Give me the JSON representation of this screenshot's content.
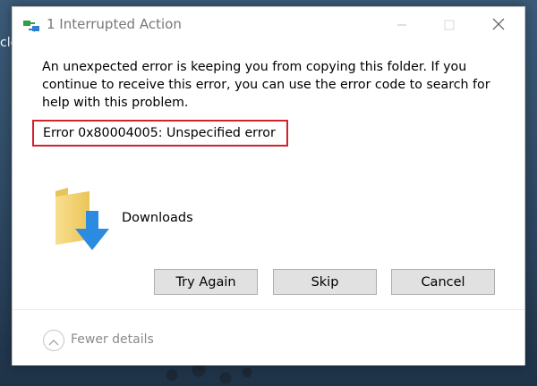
{
  "window": {
    "title": "1 Interrupted Action",
    "app_icon": "file-transfer-icon",
    "controls": [
      "minimize-icon",
      "maximize-icon",
      "close-icon"
    ]
  },
  "desktop": {
    "edge_text": "cle"
  },
  "dialog": {
    "message": "An unexpected error is keeping you from copying this folder. If you continue to receive this error, you can use the error code to search for help with this problem.",
    "error": "Error 0x80004005: Unspecified error",
    "item": {
      "icon": "downloads-folder-icon",
      "name": "Downloads"
    },
    "buttons": {
      "try_again": "Try Again",
      "skip": "Skip",
      "cancel": "Cancel"
    },
    "details_toggle": "Fewer details"
  },
  "colors": {
    "highlight_border": "#d0232e",
    "button_bg": "#e1e1e1",
    "title_text": "#777777"
  }
}
